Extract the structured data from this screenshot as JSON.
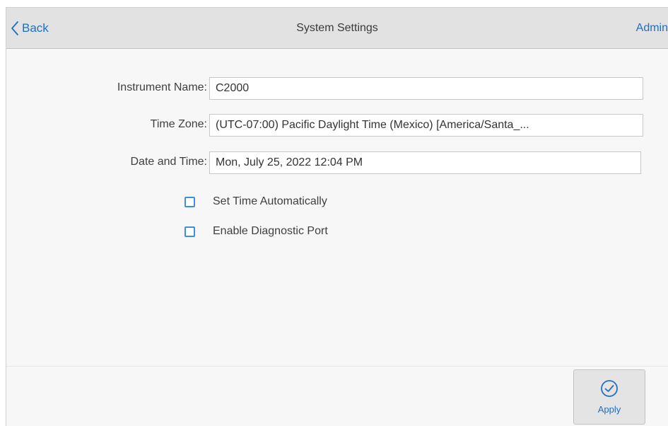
{
  "header": {
    "back_label": "Back",
    "title": "System Settings",
    "user_label": "Admin"
  },
  "form": {
    "instrument_name": {
      "label": "Instrument Name:",
      "value": "C2000"
    },
    "time_zone": {
      "label": "Time Zone:",
      "value": "(UTC-07:00) Pacific Daylight Time (Mexico) [America/Santa_..."
    },
    "date_time": {
      "label": "Date and Time:",
      "value": "Mon, July 25, 2022 12:04 PM"
    }
  },
  "options": {
    "set_time_auto": {
      "label": "Set Time Automatically",
      "checked": false
    },
    "diagnostic_port": {
      "label": "Enable Diagnostic Port",
      "checked": false
    }
  },
  "footer": {
    "apply_label": "Apply",
    "apply_icon": "checkmark-circle-icon"
  },
  "colors": {
    "accent": "#1f6fc4",
    "header_bg": "#e2e2e2",
    "panel_bg": "#f7f7f7",
    "checkbox_border": "#3f8fdc"
  }
}
